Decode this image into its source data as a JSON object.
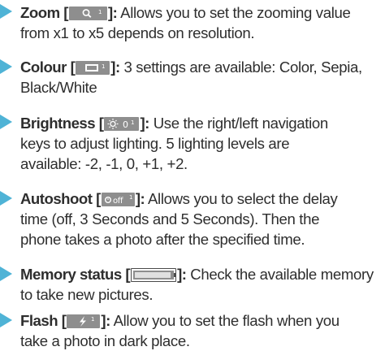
{
  "items": [
    {
      "term": "Zoom [",
      "close": "]:",
      "icon": "zoom-magnifier-icon",
      "line1": " Allows you to set the zooming value",
      "line2": "from x1 to x5 depends on resolution.",
      "line3": ""
    },
    {
      "term": "Colour [",
      "close": "]:",
      "icon": "colour-film-icon",
      "line1": " 3 settings are available: Color, Sepia,",
      "line2": "Black/White",
      "line3": ""
    },
    {
      "term": "Brightness [",
      "close": "]:",
      "icon": "brightness-sun-icon",
      "line1": " Use the right/left navigation",
      "line2": "keys to adjust lighting. 5 lighting levels are",
      "line3": "available: -2, -1, 0, +1, +2."
    },
    {
      "term": "Autoshoot [",
      "close": "]:",
      "icon": "autoshoot-timer-icon",
      "line1": " Allows you to select the delay",
      "line2": "time (off, 3 Seconds and 5 Seconds). Then the",
      "line3": "phone takes a photo after the specified time."
    },
    {
      "term": "Memory status [",
      "close": "]:",
      "icon": "memory-status-icon",
      "line1": " Check the available memory",
      "line2": "to take new pictures.",
      "line3": ""
    },
    {
      "term": "Flash [",
      "close": "]:",
      "icon": "flash-bolt-icon",
      "line1": " Allow you to set the flash when you",
      "line2": "take a photo in dark place.",
      "line3": ""
    }
  ],
  "icon_text": {
    "brightness": "0",
    "autoshoot": "off"
  },
  "colors": {
    "bullet": "#4fb3d6",
    "icon_bg": "#8e8e8e",
    "text": "#2e2e2e"
  }
}
